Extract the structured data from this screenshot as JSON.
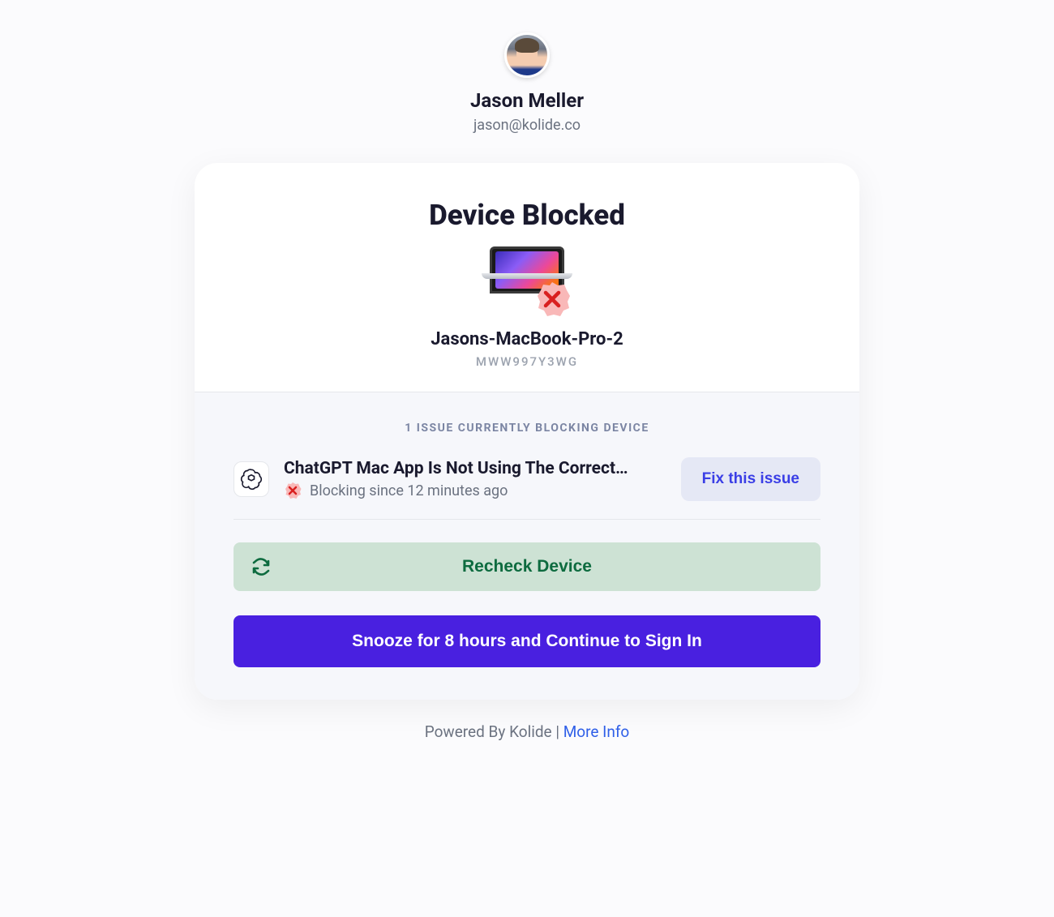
{
  "user": {
    "name": "Jason Meller",
    "email": "jason@kolide.co"
  },
  "card": {
    "title": "Device Blocked",
    "device_name": "Jasons-MacBook-Pro-2",
    "device_serial": "MWW997Y3WG"
  },
  "issues": {
    "header": "1 ISSUE CURRENTLY BLOCKING DEVICE",
    "items": [
      {
        "title": "ChatGPT Mac App Is Not Using The Correct…",
        "status": "Blocking since 12 minutes ago",
        "fix_label": "Fix this issue"
      }
    ]
  },
  "buttons": {
    "recheck": "Recheck Device",
    "snooze": "Snooze for 8 hours and Continue to Sign In"
  },
  "footer": {
    "prefix": "Powered By Kolide | ",
    "link": "More Info"
  }
}
